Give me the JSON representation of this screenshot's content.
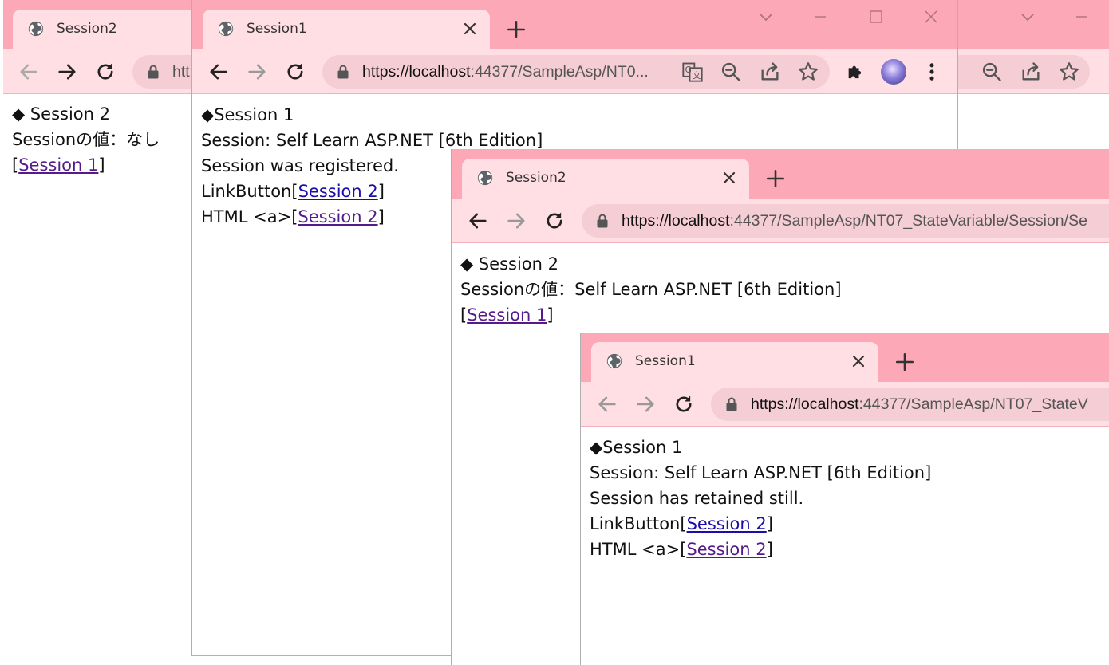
{
  "colors": {
    "frame": "#fda8b6",
    "toolbar": "#ffdfe4",
    "omnibox": "#f5cdd5",
    "link": "#1a0dab",
    "visited_link": "#551a8b"
  },
  "icons": [
    "globe-icon",
    "close-icon",
    "plus-icon",
    "back-arrow-icon",
    "forward-arrow-icon",
    "reload-icon",
    "lock-icon",
    "translate-icon",
    "zoom-out-icon",
    "share-icon",
    "star-icon",
    "puzzle-icon",
    "avatar",
    "kebab-menu-icon",
    "chevron-down-icon",
    "minimize-icon",
    "maximize-icon"
  ],
  "win_a": {
    "tab_title": "Session2",
    "url": "htt",
    "content": {
      "heading": "◆ Session 2",
      "value_line": "Sessionの値：なし",
      "link_prefix": "[",
      "link_text": "Session 1",
      "link_suffix": "]"
    }
  },
  "win_b": {
    "tab_title": "Session1",
    "url_host": "https://localhost",
    "url_rest": ":44377/SampleAsp/NT0...",
    "content": {
      "heading": "◆Session 1",
      "session_line": "Session: Self Learn ASP.NET [6th Edition]",
      "status_line": "Session was registered.",
      "linkbutton_label": "LinkButton",
      "html_a_label": "HTML <a>",
      "open_bracket": "[",
      "close_bracket": "]",
      "link_text": "Session 2"
    }
  },
  "win_c": {
    "tab_title": "Session2",
    "url_host": "https://localhost",
    "url_rest": ":44377/SampleAsp/NT07_StateVariable/Session/Se",
    "content": {
      "heading": "◆ Session 2",
      "value_line": "Sessionの値：Self Learn ASP.NET [6th Edition]",
      "link_prefix": "[",
      "link_text": "Session 1",
      "link_suffix": "]"
    }
  },
  "win_d": {
    "tab_title": "Session1",
    "url_host": "https://localhost",
    "url_rest": ":44377/SampleAsp/NT07_StateV",
    "content": {
      "heading": "◆Session 1",
      "session_line": "Session: Self Learn ASP.NET [6th Edition]",
      "status_line": "Session has retained still.",
      "linkbutton_label": "LinkButton",
      "html_a_label": "HTML <a>",
      "open_bracket": "[",
      "close_bracket": "]",
      "link_text": "Session 2"
    }
  }
}
